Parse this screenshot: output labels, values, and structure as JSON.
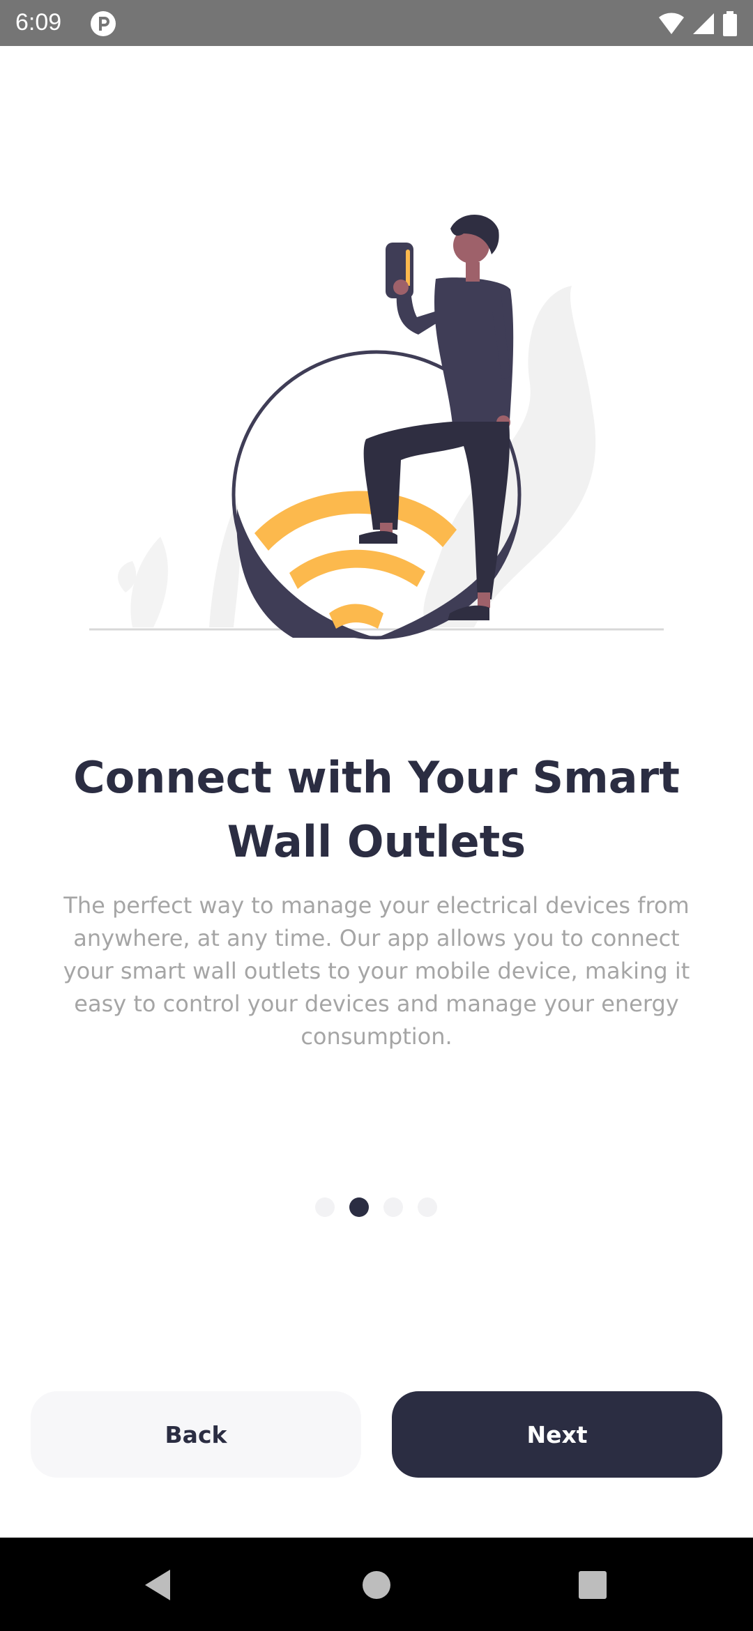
{
  "status_bar": {
    "time": "6:09",
    "icons": [
      "app-notification-icon",
      "wifi-icon",
      "signal-icon",
      "battery-icon"
    ]
  },
  "onboarding": {
    "title": "Connect with Your Smart Wall Outlets",
    "description": "The perfect way to manage your electrical devices from anywhere, at any time. Our app allows you to connect your smart wall outlets to your mobile device, making it easy to control your devices and manage your energy consumption.",
    "page_indicator": {
      "total": 4,
      "active_index": 1
    }
  },
  "buttons": {
    "back_label": "Back",
    "next_label": "Next"
  },
  "nav_bar": {
    "icons": [
      "back-triangle-icon",
      "home-circle-icon",
      "recents-square-icon"
    ]
  },
  "colors": {
    "primary": "#2b2d42",
    "accent_yellow": "#fcb94d",
    "body_text": "#a5a5a5",
    "secondary_button": "#f7f7f9"
  }
}
